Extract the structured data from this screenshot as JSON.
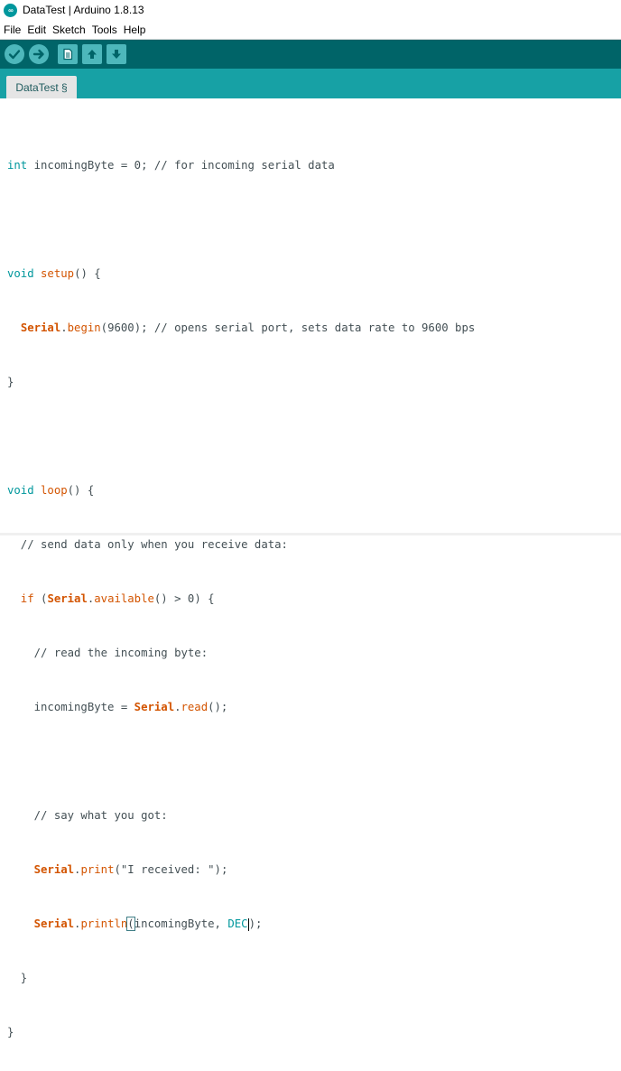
{
  "window": {
    "title": "DataTest | Arduino 1.8.13",
    "logo_text": "∞"
  },
  "menu": {
    "items": [
      "File",
      "Edit",
      "Sketch",
      "Tools",
      "Help"
    ]
  },
  "toolbar": {
    "buttons": [
      "verify-icon",
      "upload-icon",
      "new-icon",
      "open-icon",
      "save-icon"
    ]
  },
  "tab": {
    "label": "DataTest §"
  },
  "code": {
    "l1_type": "int",
    "l1_rest": " incomingByte = 0; // for incoming serial data",
    "l3_type": "void",
    "l3_fn": "setup",
    "l3_rest": "() {",
    "l4_indent": "  ",
    "l4_obj": "Serial",
    "l4_dot": ".",
    "l4_fn": "begin",
    "l4_rest": "(9600); // opens serial port, sets data rate to 9600 bps",
    "l5": "}",
    "l7_type": "void",
    "l7_fn": "loop",
    "l7_rest": "() {",
    "l8": "  // send data only when you receive data:",
    "l9_if": "  if",
    "l9_open": " (",
    "l9_obj": "Serial",
    "l9_dot": ".",
    "l9_fn": "available",
    "l9_rest": "() > 0) {",
    "l10": "    // read the incoming byte:",
    "l11_pre": "    incomingByte = ",
    "l11_obj": "Serial",
    "l11_dot": ".",
    "l11_fn": "read",
    "l11_rest": "();",
    "l13": "    // say what you got:",
    "l14_indent": "    ",
    "l14_obj": "Serial",
    "l14_dot": ".",
    "l14_fn": "print",
    "l14_rest": "(\"I received: \");",
    "l15_indent": "    ",
    "l15_obj": "Serial",
    "l15_dot": ".",
    "l15_fn": "println",
    "l15_paren": "(",
    "l15_arg": "incomingByte, ",
    "l15_const": "DEC",
    "l15_rest": ");",
    "l16": "  }",
    "l17": "}"
  },
  "colors": {
    "toolbar_bg": "#006468",
    "tabbar_bg": "#17a1a5",
    "keyword": "#00979c",
    "function": "#d35400"
  }
}
